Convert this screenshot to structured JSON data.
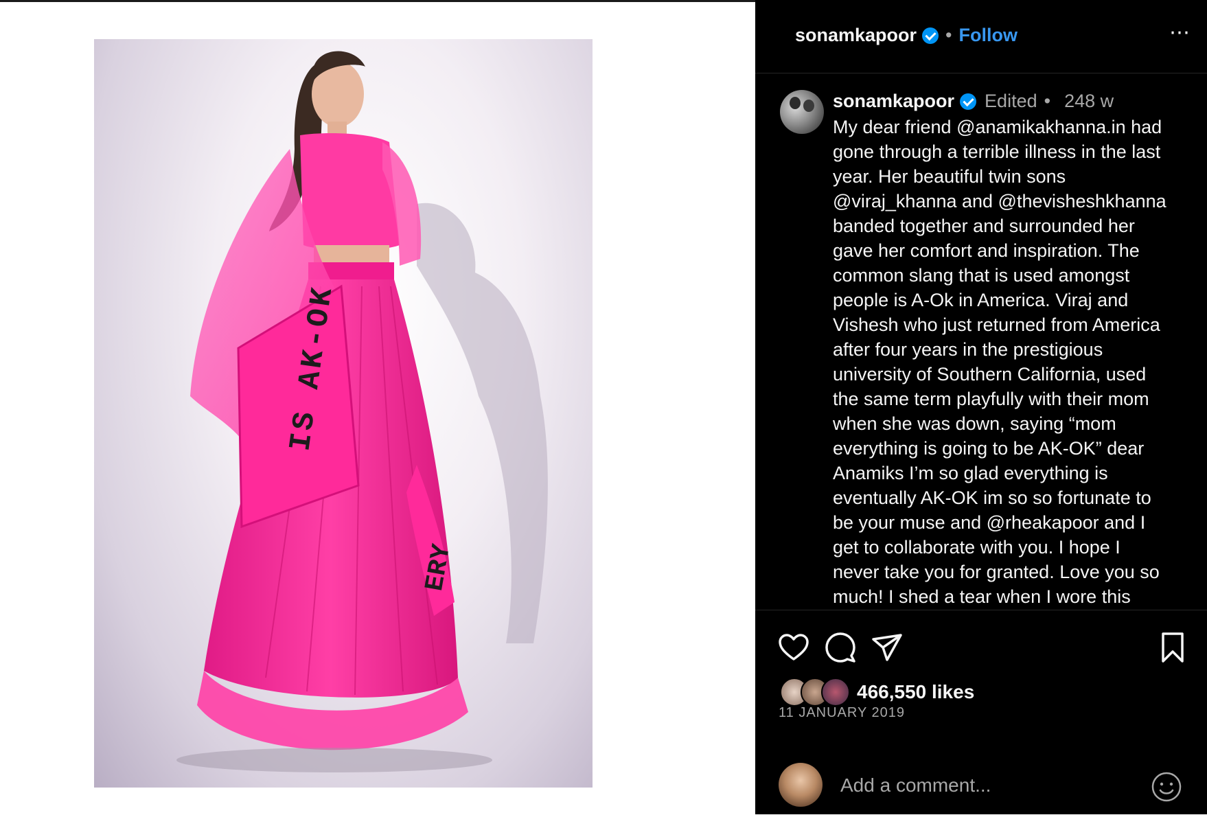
{
  "post": {
    "media_alt": "Woman in pink lehenga with AK-OK text",
    "skirt_text_1": "IS AK-OK",
    "skirt_text_2": "ERY"
  },
  "header": {
    "username": "sonamkapoor",
    "separator": "•",
    "follow_label": "Follow",
    "more_icon": "⋯"
  },
  "caption": {
    "username": "sonamkapoor",
    "edited": "Edited",
    "separator": "•",
    "time": "248 w",
    "text": "My dear friend @anamikakhanna.in had\ngone through a terrible illness in the last\nyear. Her beautiful twin sons\n@viraj_khanna and @thevisheshkhanna\nbanded together and surrounded her\ngave her comfort and inspiration. The\ncommon slang that is used amongst\npeople is A-Ok in America. Viraj and\nVishesh who just returned from America\nafter four years in the prestigious\nuniversity of Southern California, used\nthe same term playfully with their mom\nwhen she was down, saying “mom\neverything is going to be AK-OK” dear\nAnamiks I’m so glad everything is\neventually AK-OK im so so fortunate to\nbe your muse and @rheakapoor and I\nget to collaborate with you. I hope I\nnever take you for granted. Love you so\nmuch! I shed a tear when I wore this"
  },
  "engagement": {
    "likes": "466,550 likes",
    "date": "11 JANUARY 2019"
  },
  "comment": {
    "placeholder": "Add a comment..."
  },
  "icons": {
    "like": "heart-icon",
    "comment": "comment-icon",
    "share": "share-icon",
    "save": "bookmark-icon",
    "emoji": "emoji-icon",
    "verified": "verified-badge-icon"
  },
  "colors": {
    "panel_bg": "#000000",
    "accent": "#3897f0",
    "verified": "#0095f6",
    "dress": "#ff2a9a"
  }
}
